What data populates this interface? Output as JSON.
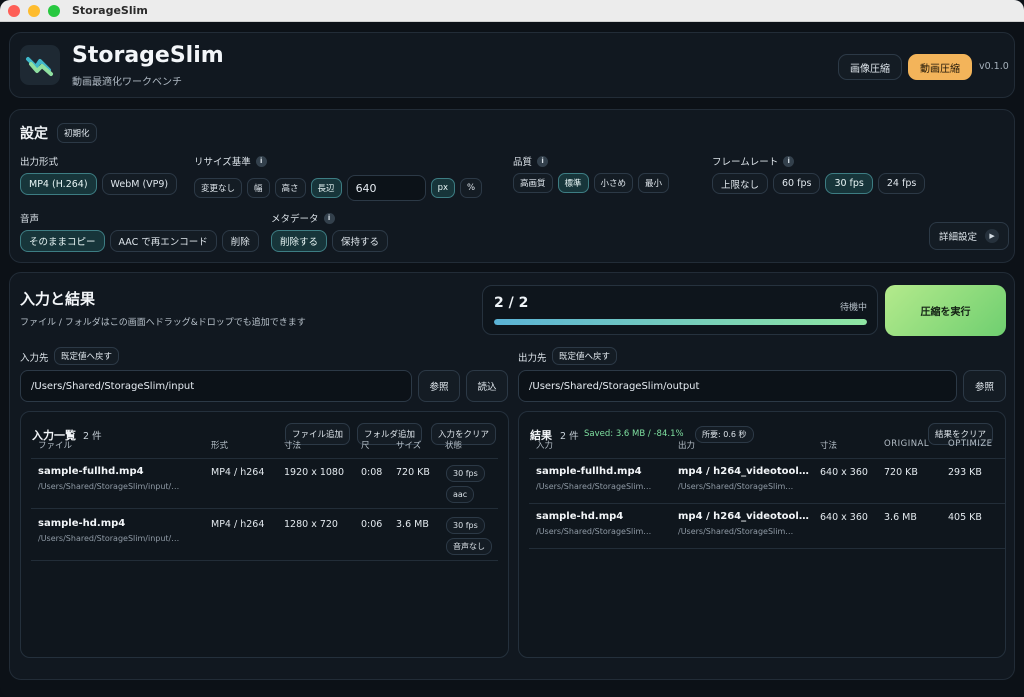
{
  "window": {
    "title": "StorageSlim"
  },
  "header": {
    "app_name": "StorageSlim",
    "subtitle": "動画最適化ワークベンチ",
    "mode_image": "画像圧縮",
    "mode_video": "動画圧縮",
    "version": "v0.1.0"
  },
  "settings": {
    "title": "設定",
    "reset": "初期化",
    "output_format": {
      "label": "出力形式",
      "options": [
        "MP4 (H.264)",
        "WebM (VP9)"
      ],
      "selected": "MP4 (H.264)"
    },
    "resize": {
      "label": "リサイズ基準",
      "options": [
        "変更なし",
        "幅",
        "高さ",
        "長辺"
      ],
      "selected": "長辺",
      "value": "640",
      "units": [
        "px",
        "%"
      ],
      "selected_unit": "px"
    },
    "quality": {
      "label": "品質",
      "options": [
        "高画質",
        "標準",
        "小さめ",
        "最小"
      ],
      "selected": "標準"
    },
    "framerate": {
      "label": "フレームレート",
      "options": [
        "上限なし",
        "60 fps",
        "30 fps",
        "24 fps"
      ],
      "selected": "30 fps"
    },
    "audio": {
      "label": "音声",
      "options": [
        "そのままコピー",
        "AAC で再エンコード",
        "削除"
      ],
      "selected": "そのままコピー"
    },
    "metadata": {
      "label": "メタデータ",
      "options": [
        "削除する",
        "保持する"
      ],
      "selected": "削除する"
    },
    "advanced": "詳細設定"
  },
  "io": {
    "title": "入力と結果",
    "hint": "ファイル / フォルダはこの画面へドラッグ&ドロップでも追加できます",
    "progress": {
      "text": "2 / 2",
      "status": "待機中",
      "fraction": 1.0
    },
    "run": "圧縮を実行",
    "input": {
      "label": "入力先",
      "reset": "既定値へ戻す",
      "path": "/Users/Shared/StorageSlim/input",
      "browse": "参照",
      "load": "読込"
    },
    "output": {
      "label": "出力先",
      "reset": "既定値へ戻す",
      "path": "/Users/Shared/StorageSlim/output",
      "browse": "参照"
    },
    "input_list": {
      "title": "入力一覧",
      "count": "2 件",
      "add_file": "ファイル追加",
      "add_folder": "フォルダ追加",
      "clear": "入力をクリア",
      "columns": [
        "ファイル",
        "形式",
        "寸法",
        "尺",
        "サイズ",
        "状態"
      ],
      "rows": [
        {
          "name": "sample-fullhd.mp4",
          "path": "/Users/Shared/StorageSlim/input/…",
          "format": "MP4 / h264",
          "dims": "1920 x 1080",
          "duration": "0:08",
          "size": "720 KB",
          "badges": [
            "30 fps",
            "aac"
          ]
        },
        {
          "name": "sample-hd.mp4",
          "path": "/Users/Shared/StorageSlim/input/…",
          "format": "MP4 / h264",
          "dims": "1280 x 720",
          "duration": "0:06",
          "size": "3.6 MB",
          "badges": [
            "30 fps",
            "音声なし"
          ]
        }
      ]
    },
    "results": {
      "title": "結果",
      "count": "2 件",
      "saved": "Saved: 3.6 MB / -84.1%",
      "elapsed": "所要: 0.6 秒",
      "clear": "結果をクリア",
      "columns": [
        "入力",
        "出力",
        "寸法",
        "ORIGINAL",
        "OPTIMIZE"
      ],
      "rows": [
        {
          "input": "sample-fullhd.mp4",
          "input_path": "/Users/Shared/StorageSlim…",
          "output": "mp4 / h264_videotool…",
          "output_path": "/Users/Shared/StorageSlim…",
          "dims": "640 x 360",
          "original": "720 KB",
          "optimized": "293 KB"
        },
        {
          "input": "sample-hd.mp4",
          "input_path": "/Users/Shared/StorageSlim…",
          "output": "mp4 / h264_videotool…",
          "output_path": "/Users/Shared/StorageSlim…",
          "dims": "640 x 360",
          "original": "3.6 MB",
          "optimized": "405 KB"
        }
      ]
    }
  },
  "colors": {
    "accent_teal": "#3d7d83",
    "run_green": "#6fcf70",
    "mode_orange": "#f3b45a",
    "saved_green": "#7fe0a0"
  }
}
